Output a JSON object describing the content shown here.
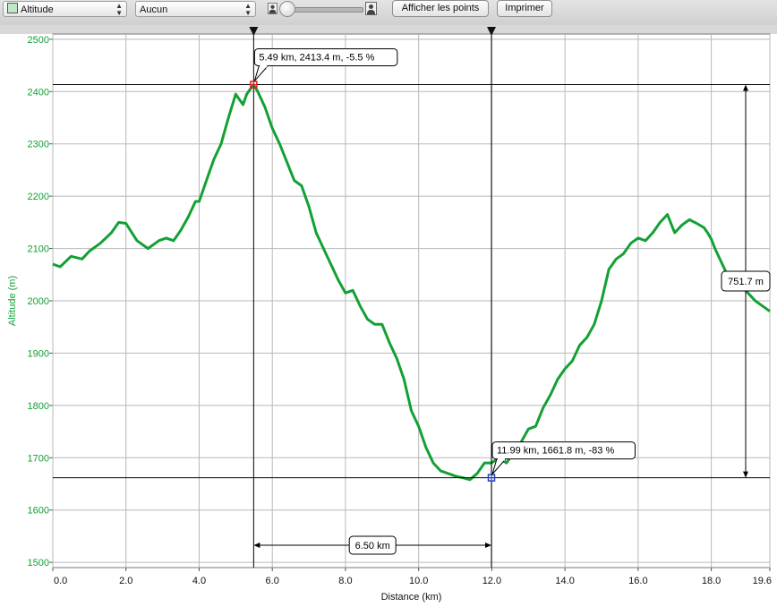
{
  "toolbar": {
    "series_select": "Altitude",
    "secondary_select": "Aucun",
    "show_points_button": "Afficher les points",
    "print_button": "Imprimer"
  },
  "colors": {
    "line": "#13a035",
    "y_axis_text": "#13a035",
    "marker_start": "#e02020",
    "marker_end": "#2040c0"
  },
  "chart_data": {
    "type": "line",
    "xlabel": "Distance (km)",
    "ylabel": "Altitude (m)",
    "xlim": [
      0,
      19.6
    ],
    "ylim": [
      1490,
      2510
    ],
    "x_ticks": [
      "0.0",
      "2.0",
      "4.0",
      "6.0",
      "8.0",
      "10.0",
      "12.0",
      "14.0",
      "16.0",
      "18.0",
      "19.6"
    ],
    "y_ticks": [
      "1500",
      "1600",
      "1700",
      "1800",
      "1900",
      "2000",
      "2100",
      "2200",
      "2300",
      "2400",
      "2500"
    ],
    "grid": true,
    "series": [
      {
        "x": [
          0,
          0.2,
          0.5,
          0.8,
          1.0,
          1.3,
          1.6,
          1.8,
          2.0,
          2.3,
          2.6,
          2.9,
          3.1,
          3.3,
          3.5,
          3.7,
          3.9,
          4.0,
          4.2,
          4.4,
          4.6,
          4.8,
          5.0,
          5.1,
          5.2,
          5.3,
          5.4,
          5.49,
          5.6,
          5.8,
          6.0,
          6.2,
          6.4,
          6.6,
          6.8,
          7.0,
          7.2,
          7.4,
          7.6,
          7.8,
          8.0,
          8.2,
          8.4,
          8.6,
          8.8,
          9.0,
          9.2,
          9.4,
          9.6,
          9.8,
          10.0,
          10.2,
          10.4,
          10.6,
          10.8,
          11.0,
          11.2,
          11.4,
          11.6,
          11.8,
          11.99,
          12.2,
          12.4,
          12.6,
          12.8,
          13.0,
          13.2,
          13.4,
          13.6,
          13.8,
          14.0,
          14.2,
          14.4,
          14.6,
          14.8,
          15.0,
          15.2,
          15.4,
          15.6,
          15.8,
          16.0,
          16.2,
          16.4,
          16.6,
          16.8,
          17.0,
          17.2,
          17.4,
          17.6,
          17.8,
          17.9,
          18.0,
          18.1,
          18.3,
          18.4,
          18.6,
          18.8,
          19.0,
          19.2,
          19.4,
          19.6
        ],
        "values": [
          2070,
          2065,
          2085,
          2080,
          2095,
          2110,
          2130,
          2150,
          2148,
          2115,
          2100,
          2115,
          2120,
          2115,
          2135,
          2160,
          2190,
          2190,
          2230,
          2270,
          2300,
          2350,
          2395,
          2385,
          2375,
          2395,
          2405,
          2413,
          2400,
          2370,
          2330,
          2300,
          2265,
          2230,
          2220,
          2180,
          2130,
          2100,
          2070,
          2040,
          2015,
          2020,
          1990,
          1965,
          1955,
          1955,
          1920,
          1890,
          1850,
          1790,
          1760,
          1720,
          1690,
          1675,
          1670,
          1665,
          1661.8,
          1658,
          1670,
          1690,
          1690,
          1700,
          1690,
          1710,
          1730,
          1755,
          1760,
          1795,
          1820,
          1850,
          1870,
          1885,
          1915,
          1930,
          1955,
          2000,
          2060,
          2080,
          2090,
          2110,
          2120,
          2115,
          2130,
          2150,
          2165,
          2130,
          2145,
          2155,
          2148,
          2140,
          2130,
          2118,
          2100,
          2070,
          2055,
          2040,
          2030,
          2015,
          2000,
          1990,
          1980
        ],
        "values_display_note_removed": null
      }
    ],
    "markers": [
      {
        "x": 5.49,
        "y": 2413.4,
        "label": "5.49 km, 2413.4 m, -5.5 %"
      },
      {
        "x": 11.99,
        "y": 1661.8,
        "label": "11.99 km, 1661.8 m, -83 %"
      }
    ],
    "distance_label": "6.50 km",
    "altitude_diff_label": "751.7 m"
  }
}
